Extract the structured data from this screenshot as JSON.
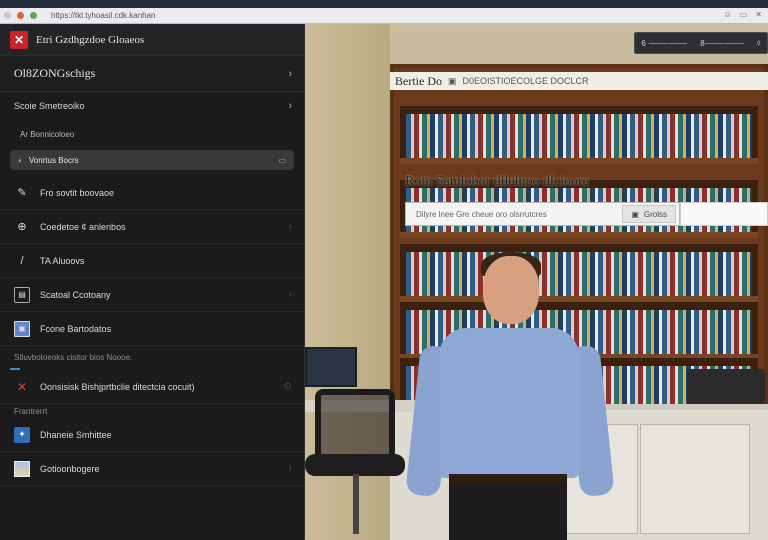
{
  "browser": {
    "address": "https://tkl.tyhoasil.cdk.kanhan",
    "icons": [
      "minimize-icon",
      "restore-icon",
      "close-icon"
    ],
    "right_labels": [
      "☺",
      "▭",
      "✕"
    ]
  },
  "sidebar": {
    "app_title": "Etri Gzdhgzdoe Gloaeos",
    "logo_glyph": "✕",
    "section1": {
      "label": "Ol8ZONGschigs",
      "chevron": "›"
    },
    "row1": {
      "label": "Scoie Smetreoiko",
      "chevron": "›"
    },
    "row2": {
      "label": "Ar Bonnicoloeo"
    },
    "selected_row": {
      "label": "Vonrtus Bocrs",
      "pill": "▭"
    },
    "items": [
      {
        "icon": "pen-tool-icon",
        "glyph": "✎",
        "label": "Fro sovtit boovaoe",
        "chevron": ""
      },
      {
        "icon": "compass-icon",
        "glyph": "⊕",
        "label": "Coedetoe ¢ anlenbos",
        "chevron": "›"
      },
      {
        "icon": "slash-tool-icon",
        "glyph": "/",
        "label": "TA Aluoovs",
        "chevron": ""
      },
      {
        "icon": "document-icon",
        "glyph": "▤",
        "label": "Scatoal Ccotoany",
        "chevron": "›"
      },
      {
        "icon": "image-icon",
        "glyph": "▣",
        "label": "Fcone Bartodatos",
        "chevron": ""
      }
    ],
    "note1": "Stluvbotoeoks cisitor bios Noooe.",
    "highlight_item": {
      "icon": "red-x-icon",
      "glyph": "✕",
      "label": "Oonsisisk Bishjprtbclie ditectcia cocuit)",
      "badge": "⊙"
    },
    "note2": "Frantrerrt",
    "items2": [
      {
        "icon": "sparkle-icon",
        "glyph": "✦",
        "label": "Dhaneie Smhittee",
        "chevron": ""
      },
      {
        "icon": "photo-icon",
        "glyph": "",
        "label": "Gotioonbogere",
        "chevron": "›"
      }
    ]
  },
  "scene": {
    "toolbar": [
      "6 ⸻⸻",
      "8⸻⸻",
      "⬨"
    ],
    "title_bar": {
      "title": "Bertie Do",
      "icon": "▣",
      "text": "D0EOISTIOECOLGE DOCLCR"
    },
    "caption": "Rotn Samiobor dilelnoo dlcioore",
    "search": {
      "placeholder": "Dilyre lnee Gre cheue oro olsrrutcres",
      "button": "Grolss",
      "button_icon": "▣"
    }
  }
}
